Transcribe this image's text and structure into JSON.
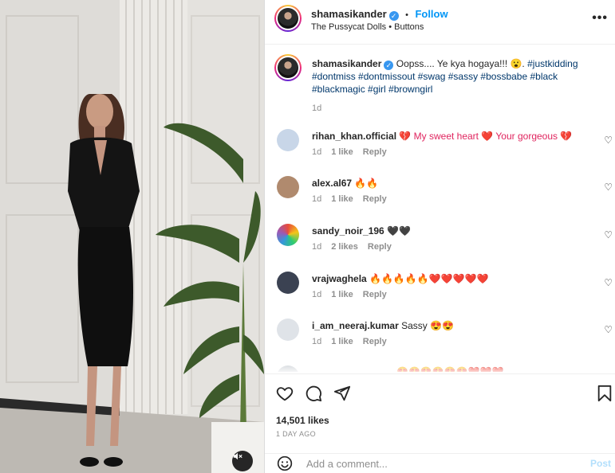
{
  "post": {
    "username": "shamasikander",
    "verified_icon": "verified-badge-icon",
    "separator": "•",
    "follow_label": "Follow",
    "audio": "The Pussycat Dolls • Buttons",
    "more_icon": "more-options-icon",
    "mute_icon": "muted-speaker-icon"
  },
  "caption": {
    "username": "shamasikander",
    "text": "Oopss.... Ye kya hogaya!!! 😮.",
    "hashtags": "#justkidding #dontmiss #dontmissout #swag #sassy #bossbabe #black #blackmagic #girl #browngirl",
    "time": "1d"
  },
  "comments": [
    {
      "username": "rihan_khan.official",
      "text": "💔 My sweet heart ❤️ Your gorgeous 💔",
      "time": "1d",
      "likes": "1 like",
      "reply": "Reply",
      "avatar_color": "#c8d6e8"
    },
    {
      "username": "alex.al67",
      "text": "🔥🔥",
      "time": "1d",
      "likes": "1 like",
      "reply": "Reply",
      "avatar_color": "#b08a6e"
    },
    {
      "username": "sandy_noir_196",
      "text": "🖤🖤",
      "time": "1d",
      "likes": "2 likes",
      "reply": "Reply",
      "avatar_color": "#e84b3c"
    },
    {
      "username": "vrajwaghela",
      "text": "🔥🔥🔥🔥🔥❤️❤️❤️❤️❤️",
      "time": "1d",
      "likes": "1 like",
      "reply": "Reply",
      "avatar_color": "#3b4252"
    },
    {
      "username": "i_am_neeraj.kumar",
      "text": "Sassy 😍😍",
      "time": "1d",
      "likes": "1 like",
      "reply": "Reply",
      "avatar_color": "#dfe3e8"
    }
  ],
  "partial_comment_text": "😍😍😍😍😍😍❤️❤️❤️",
  "actions": {
    "like_icon": "heart-outline-icon",
    "comment_icon": "comment-bubble-icon",
    "share_icon": "paper-plane-icon",
    "save_icon": "bookmark-icon",
    "likes": "14,501 likes",
    "date": "1 DAY AGO"
  },
  "composer": {
    "emoji_icon": "smiley-face-icon",
    "placeholder": "Add a comment...",
    "post_label": "Post"
  }
}
